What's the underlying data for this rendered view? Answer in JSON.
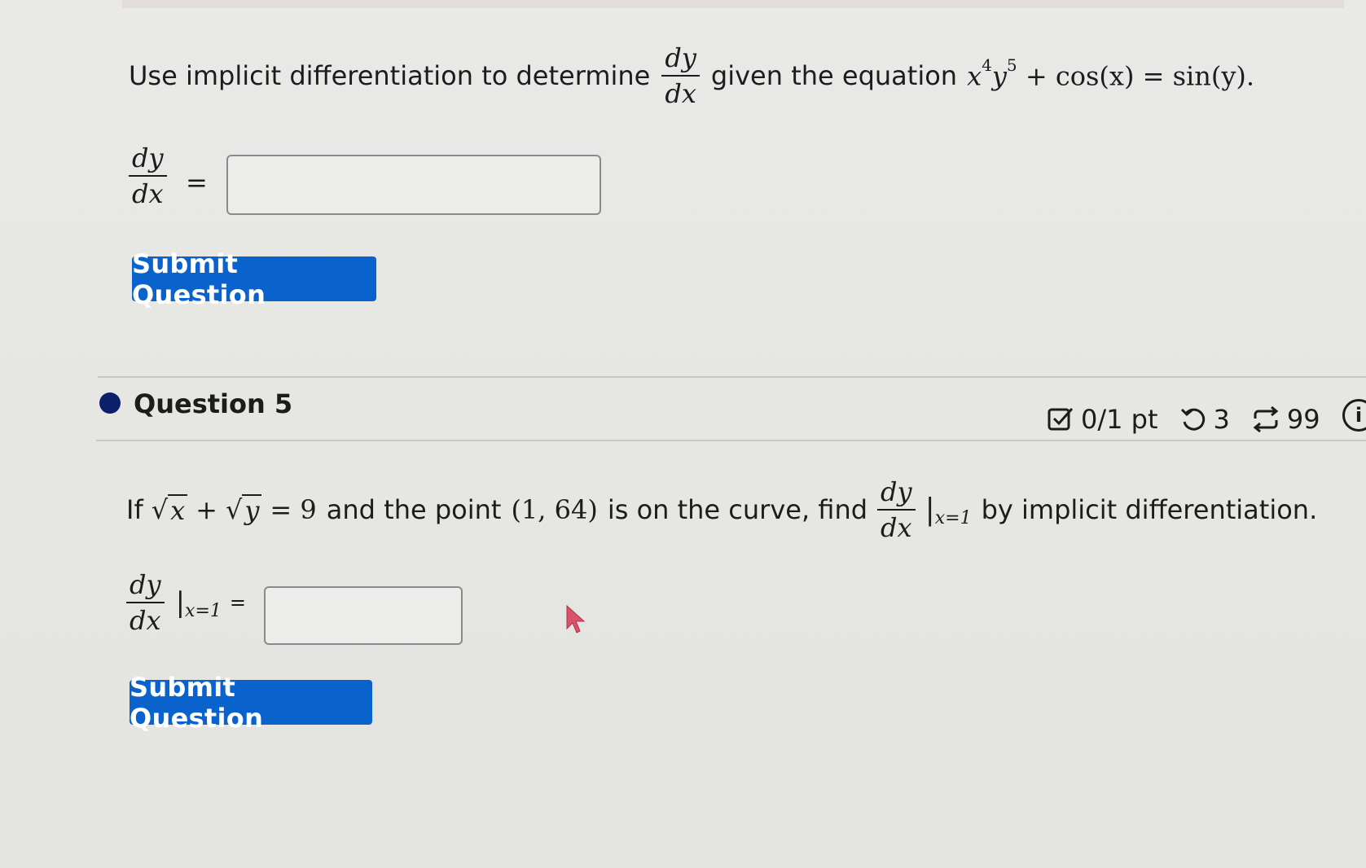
{
  "question4": {
    "prompt_before": "Use implicit differentiation to determine",
    "prompt_between": "given the equation",
    "deriv_num": "dy",
    "deriv_den": "dx",
    "equation": {
      "x": "x",
      "x_exp": "4",
      "y": "y",
      "y_exp": "5",
      "rest": " + cos(x) = sin(y)."
    },
    "answer_label_num": "dy",
    "answer_label_den": "dx",
    "answer_equals": "=",
    "answer_value": "",
    "submit_label": "Submit Question"
  },
  "question5": {
    "title": "Question 5",
    "score": "0/1 pt",
    "attempts": "3",
    "retries": "99",
    "info_icon": "i",
    "prompt_if": "If",
    "sqrt_x": "x",
    "plus": "+",
    "sqrt_y": "y",
    "eq_rhs": "= 9",
    "prompt_mid": "and the point",
    "point": "(1, 64)",
    "prompt_mid2": "is on the curve, find",
    "deriv_num": "dy",
    "deriv_den": "dx",
    "eval_at": "x=1",
    "prompt_end": "by implicit differentiation.",
    "answer_label_num": "dy",
    "answer_label_den": "dx",
    "answer_eval_at": "x=1",
    "answer_equals": "=",
    "answer_value": "",
    "submit_label": "Submit Question"
  },
  "icons": {
    "score": "checkbox-icon",
    "attempts": "undo-icon",
    "retries": "retry-icon",
    "info": "info-icon",
    "cursor": "cursor-icon",
    "bullet": "bullet-dot-icon"
  },
  "colors": {
    "button": "#0a63cc",
    "bullet": "#0b1f6b",
    "background": "#e8e8e6",
    "cursor": "#d9536a"
  }
}
